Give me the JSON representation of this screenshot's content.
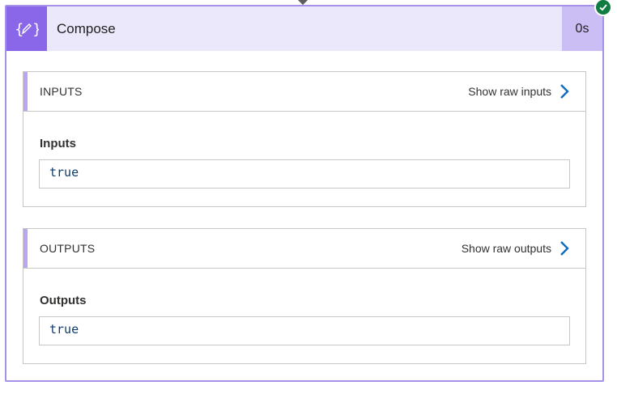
{
  "action": {
    "title": "Compose",
    "duration": "0s",
    "icon": "compose-braces-icon",
    "status_icon": "check-circle-icon",
    "colors": {
      "icon_bg": "#8a66e8",
      "header_bg": "#ece8fb",
      "duration_bg": "#cbbef5",
      "border": "#a591e8",
      "success": "#107c41",
      "chevron": "#0f6cbd"
    }
  },
  "inputs_section": {
    "title": "INPUTS",
    "show_raw_label": "Show raw inputs",
    "field_label": "Inputs",
    "field_value": "true"
  },
  "outputs_section": {
    "title": "OUTPUTS",
    "show_raw_label": "Show raw outputs",
    "field_label": "Outputs",
    "field_value": "true"
  }
}
